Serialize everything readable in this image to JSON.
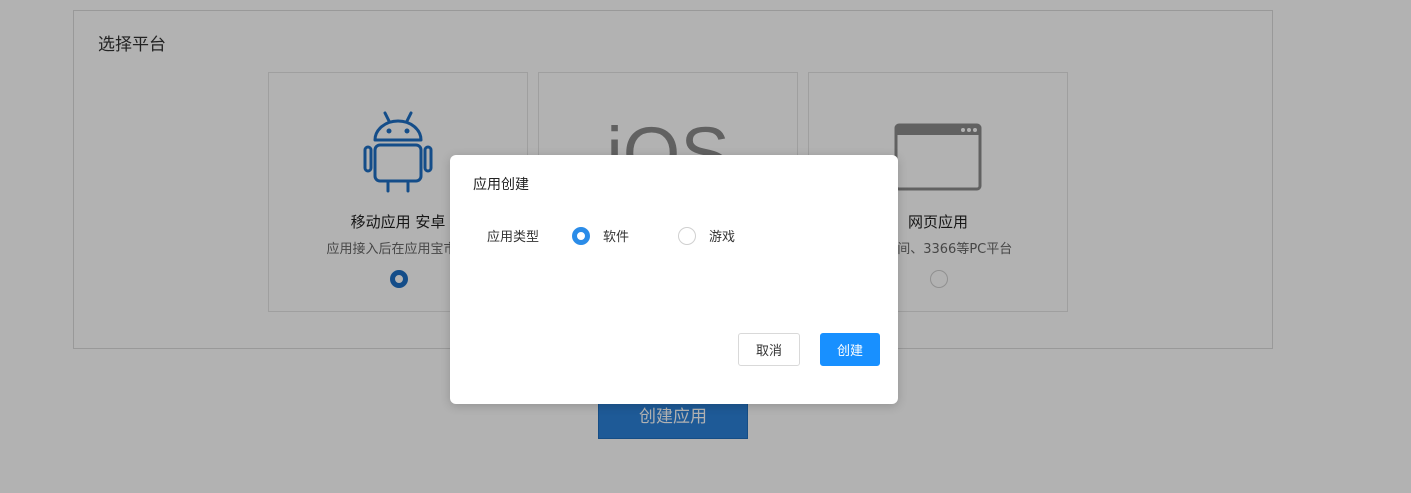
{
  "platform_panel": {
    "title": "选择平台",
    "cards": [
      {
        "title": "移动应用 安卓",
        "desc": "应用接入后在应用宝市场",
        "selected": true,
        "icon": "android-icon",
        "icon_color": "#1e6fc4"
      },
      {
        "title": "",
        "desc": "",
        "selected": false,
        "icon": "ios-icon",
        "icon_color": "#8c8c8c",
        "logo_text": "iOS"
      },
      {
        "title": "网页应用",
        "desc": "QQ空间、3366等PC平台",
        "selected": false,
        "icon": "browser-window-icon",
        "icon_color": "#8c8c8c"
      }
    ]
  },
  "create_app_button": {
    "label": "创建应用"
  },
  "modal": {
    "title": "应用创建",
    "field_label": "应用类型",
    "options": [
      {
        "label": "软件",
        "selected": true
      },
      {
        "label": "游戏",
        "selected": false
      }
    ],
    "cancel_label": "取消",
    "create_label": "创建"
  },
  "colors": {
    "primary": "#1890ff",
    "android_blue": "#1e6fc4",
    "overlay": "rgba(0,0,0,0.30)"
  }
}
